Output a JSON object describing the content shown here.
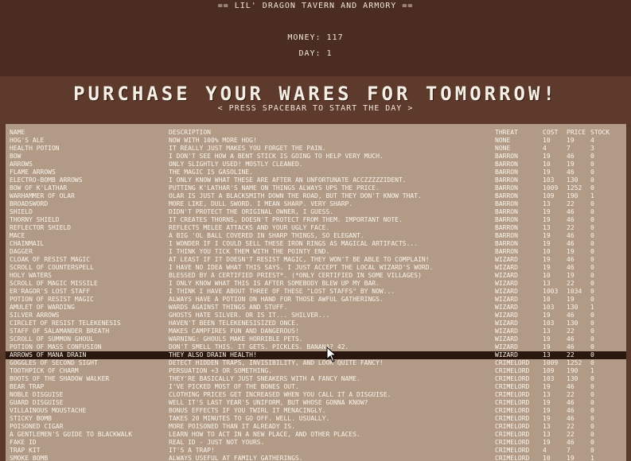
{
  "header": {
    "title": "== LIL' DRAGON TAVERN AND ARMORY ==",
    "money_label": "MONEY: 117",
    "day_label": "DAY: 1"
  },
  "heading": "PURCHASE YOUR WARES FOR TOMORROW!",
  "subheading": "< PRESS SPACEBAR TO START THE DAY >",
  "columns": {
    "name": "NAME",
    "description": "DESCRIPTION",
    "threat": "THREAT",
    "cost": "COST",
    "price": "PRICE",
    "stock": "STOCK"
  },
  "selected_index": 27,
  "items": [
    {
      "name": "HOG'S ALE",
      "description": "NOW WITH 100% MORE HOG!",
      "threat": "NONE",
      "cost": "10",
      "price": "19",
      "stock": "4"
    },
    {
      "name": "HEALTH POTION",
      "description": "IT REALLY JUST MAKES YOU FORGET THE PAIN.",
      "threat": "NONE",
      "cost": "4",
      "price": "7",
      "stock": "3"
    },
    {
      "name": "BOW",
      "description": "I DON'T SEE HOW A BENT STICK IS GOING TO HELP VERY MUCH.",
      "threat": "BARRON",
      "cost": "19",
      "price": "46",
      "stock": "0"
    },
    {
      "name": "ARROWS",
      "description": "ONLY SLIGHTLY USED! MOSTLY CLEANED.",
      "threat": "BARRON",
      "cost": "10",
      "price": "19",
      "stock": "0"
    },
    {
      "name": "FLAME ARROWS",
      "description": "THE MAGIC IS GASOLINE.",
      "threat": "BARRON",
      "cost": "19",
      "price": "46",
      "stock": "0"
    },
    {
      "name": "ELECTRO-BOMB ARROWS",
      "description": "I ONLY KNOW WHAT THESE ARE AFTER AN UNFORTUNATE ACCZZZZZIDENT.",
      "threat": "BARRON",
      "cost": "103",
      "price": "130",
      "stock": "0"
    },
    {
      "name": "BOW OF K'LATHAR",
      "description": "PUTTING K'LATHAR'S NAME ON THINGS ALWAYS UPS THE PRICE.",
      "threat": "BARRON",
      "cost": "1009",
      "price": "1252",
      "stock": "0"
    },
    {
      "name": "WARHAMMER OF OLAR",
      "description": "OLAR IS JUST A BLACKSMITH DOWN THE ROAD, BUT THEY DON'T KNOW THAT.",
      "threat": "BARRON",
      "cost": "109",
      "price": "190",
      "stock": "1"
    },
    {
      "name": "BROADSWORD",
      "description": "MORE LIKE, DULL SWORD. I MEAN SHARP. VERY SHARP.",
      "threat": "BARRON",
      "cost": "13",
      "price": "22",
      "stock": "0"
    },
    {
      "name": "SHIELD",
      "description": "DIDN'T PROTECT THE ORIGINAL OWNER, I GUESS.",
      "threat": "BARRON",
      "cost": "19",
      "price": "46",
      "stock": "0"
    },
    {
      "name": "THORNY SHIELD",
      "description": "IT CREATES THORNS, DOESN'T PROTECT FROM THEM. IMPORTANT NOTE.",
      "threat": "BARRON",
      "cost": "19",
      "price": "46",
      "stock": "0"
    },
    {
      "name": "REFLECTOR SHIELD",
      "description": "REFLECTS MELEE ATTACKS AND YOUR UGLY FACE.",
      "threat": "BARRON",
      "cost": "13",
      "price": "22",
      "stock": "0"
    },
    {
      "name": "MACE",
      "description": "A BIG 'OL BALL COVERED IN SHARP THINGS, SO ELEGANT.",
      "threat": "BARRON",
      "cost": "19",
      "price": "46",
      "stock": "0"
    },
    {
      "name": "CHAINMAIL",
      "description": "I WONDER IF I COULD SELL THESE IRON RINGS AS MAGICAL ARTIFACTS...",
      "threat": "BARRON",
      "cost": "19",
      "price": "46",
      "stock": "0"
    },
    {
      "name": "DAGGER",
      "description": "I THINK YOU TICK THEM WITH THE POINTY END.",
      "threat": "BARRON",
      "cost": "10",
      "price": "19",
      "stock": "0"
    },
    {
      "name": "CLOAK OF RESIST MAGIC",
      "description": "AT LEAST IF IT DOESN'T RESIST MAGIC, THEY WON'T BE ABLE TO COMPLAIN!",
      "threat": "WIZARD",
      "cost": "19",
      "price": "46",
      "stock": "0"
    },
    {
      "name": "SCROLL OF COUNTERSPELL",
      "description": "I HAVE NO IDEA WHAT THIS SAYS. I JUST ACCEPT THE LOCAL WIZARD'S WORD.",
      "threat": "WIZARD",
      "cost": "19",
      "price": "46",
      "stock": "0"
    },
    {
      "name": "HOLY WATERS",
      "description": "BLESSED BY A CERTIFIED PRIEST*. (*ONLY CERTIFIED IN SOME VILLAGES)",
      "threat": "WIZARD",
      "cost": "10",
      "price": "19",
      "stock": "0"
    },
    {
      "name": "SCROLL OF MAGIC MISSILE",
      "description": "I ONLY KNOW WHAT THIS IS AFTER SOMEBODY BLEW UP MY BAR.",
      "threat": "WIZARD",
      "cost": "13",
      "price": "22",
      "stock": "0"
    },
    {
      "name": "ER'RAGOR'S LOST STAFF",
      "description": "I THINK I HAVE ABOUT THREE OF THESE \"LOST STAFFS\" BY NOW...",
      "threat": "WIZARD",
      "cost": "1003",
      "price": "1034",
      "stock": "0"
    },
    {
      "name": "POTION OF RESIST MAGIC",
      "description": "ALWAYS HAVE A POTION ON HAND FOR THOSE AWFUL GATHERINGS.",
      "threat": "WIZARD",
      "cost": "10",
      "price": "19",
      "stock": "0"
    },
    {
      "name": "AMULET OF WARDING",
      "description": "WARDS AGAINST THINGS AND STUFF.",
      "threat": "WIZARD",
      "cost": "103",
      "price": "130",
      "stock": "1"
    },
    {
      "name": "SILVER ARROWS",
      "description": "GHOSTS HATE SILVER. OR IS IT... SHILVER...",
      "threat": "WIZARD",
      "cost": "19",
      "price": "46",
      "stock": "0"
    },
    {
      "name": "CIRCLET OF RESIST TELEKENESIS",
      "description": "HAVEN'T BEEN TELEKENESISIZED ONCE.",
      "threat": "WIZARD",
      "cost": "103",
      "price": "130",
      "stock": "0"
    },
    {
      "name": "STAFF OF SALAMANDER BREATH",
      "description": "MAKES CAMPFIRES FUN AND DANGEROUS!",
      "threat": "WIZARD",
      "cost": "13",
      "price": "22",
      "stock": "0"
    },
    {
      "name": "SCROLL OF SUMMON GHOUL",
      "description": "WARNING: GHOULS MAKE HORRIBLE PETS.",
      "threat": "WIZARD",
      "cost": "19",
      "price": "46",
      "stock": "0"
    },
    {
      "name": "POTION OF MASS CONFUSION",
      "description": "DON'T SMELL THIS. IT GETS. PICKLES. BANANA? 42.",
      "threat": "WIZARD",
      "cost": "19",
      "price": "46",
      "stock": "0"
    },
    {
      "name": "ARROWS OF MANA DRAIN",
      "description": "THEY ALSO DRAIN HEALTH!",
      "threat": "WIZARD",
      "cost": "13",
      "price": "22",
      "stock": "0"
    },
    {
      "name": "GOGGLES OF SECOND SIGHT",
      "description": "DETECT HIDDEN TRAPS, INVISIBILITY, AND LOOK QUITE FANCY!",
      "threat": "CRIMELORD",
      "cost": "1009",
      "price": "1252",
      "stock": "0"
    },
    {
      "name": "TOOTHPICK OF CHARM",
      "description": "PERSUATION +3 OR SOMETHING.",
      "threat": "CRIMELORD",
      "cost": "109",
      "price": "190",
      "stock": "1"
    },
    {
      "name": "BOOTS OF THE SHADOW WALKER",
      "description": "THEY'RE BASICALLY JUST SNEAKERS WITH A FANCY NAME.",
      "threat": "CRIMELORD",
      "cost": "103",
      "price": "130",
      "stock": "0"
    },
    {
      "name": "BEAR TRAP",
      "description": "I'VE PICKED MOST OF THE BONES OUT.",
      "threat": "CRIMELORD",
      "cost": "19",
      "price": "46",
      "stock": "0"
    },
    {
      "name": "NOBLE DISGUISE",
      "description": "CLOTHING PRICES GET INCREASED WHEN YOU CALL IT A DISGUISE.",
      "threat": "CRIMELORD",
      "cost": "13",
      "price": "22",
      "stock": "0"
    },
    {
      "name": "GUARD DISGUISE",
      "description": "WELL IT'S LAST YEAR'S UNIFORM, BUT WHOSE GONNA KNOW?",
      "threat": "CRIMELORD",
      "cost": "19",
      "price": "46",
      "stock": "0"
    },
    {
      "name": "VILLAINOUS MOUSTACHE",
      "description": "BONUS EFFECTS IF YOU TWIRL IT MENACINGLY.",
      "threat": "CRIMELORD",
      "cost": "19",
      "price": "46",
      "stock": "0"
    },
    {
      "name": "STICKY BOMB",
      "description": "TAKES 20 MINUTES TO GO OFF. WELL. USUALLY.",
      "threat": "CRIMELORD",
      "cost": "19",
      "price": "46",
      "stock": "0"
    },
    {
      "name": "POISONED CIGAR",
      "description": "MORE POISONED THAN IT ALREADY IS.",
      "threat": "CRIMELORD",
      "cost": "13",
      "price": "22",
      "stock": "0"
    },
    {
      "name": "A GENTLEMEN'S GUIDE TO BLACKWALK",
      "description": "LEARN HOW TO ACT IN A NEW PLACE, AND OTHER PLACES.",
      "threat": "CRIMELORD",
      "cost": "13",
      "price": "22",
      "stock": "0"
    },
    {
      "name": "FAKE ID",
      "description": "REAL ID - JUST NOT YOURS.",
      "threat": "CRIMELORD",
      "cost": "19",
      "price": "46",
      "stock": "0"
    },
    {
      "name": "TRAP KIT",
      "description": "IT'S A TRAP!",
      "threat": "CRIMELORD",
      "cost": "4",
      "price": "7",
      "stock": "0"
    },
    {
      "name": "SMOKE BOMB",
      "description": "ALWAYS USEFUL AT FAMILY GATHERINGS.",
      "threat": "CRIMELORD",
      "cost": "10",
      "price": "19",
      "stock": "1"
    }
  ]
}
